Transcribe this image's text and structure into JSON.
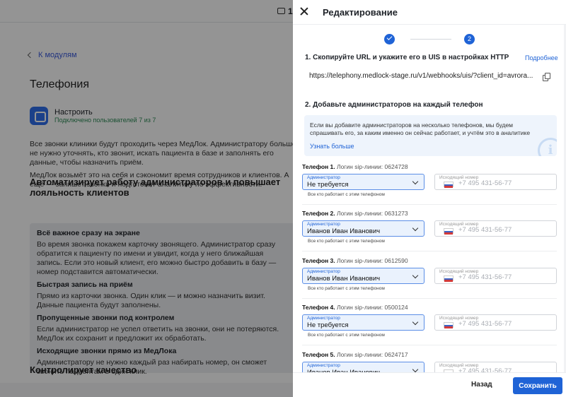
{
  "background": {
    "top_number": "1",
    "back_link": "К модулям",
    "page_title": "Телефония",
    "app": {
      "name": "Настроить",
      "status": "Подключено пользователей 7 из 7"
    },
    "intro_p1": "Все звонки клиники будут проходить через МедЛок. Администратору больше не нужно уточнять, кто звонит, искать пациента в базе и заполнять его данные, чтобы назначить приём.",
    "intro_p2": "МедЛок возьмёт это на себя и сэкономит время сотрудников и клиентов. А ещё — запишет звонки и подготовит аналитику по эффективности.",
    "section1_title": "Автоматизирует работу администраторов и повышает лояльность клиентов",
    "features": [
      {
        "title": "Всё важное сразу на экране",
        "text": "Во время звонка покажем карточку звонящего. Администратор сразу обратится к пациенту по имени и увидит, когда у него ближайшая запись. Если это новый клиент, его можно быстро добавить в базу — номер подставится автоматически."
      },
      {
        "title": "Быстрая запись на приём",
        "text": "Прямо из карточки звонка. Один клик — и можно назначить визит. Данные пациента будут заполнены."
      },
      {
        "title": "Пропущенные звонки под контролем",
        "text": "Если администратор не успел ответить на звонки, они не потеряются. МедЛок их сохранит и предложит их обработать."
      },
      {
        "title": "Исходящие звонки прямо из МедЛока",
        "text": "Администратору не нужно каждый раз набирать номер, он сможет звонить пациентам в один клик."
      }
    ],
    "section2_title": "Контролирует качество"
  },
  "drawer": {
    "title": "Редактирование",
    "steps": [
      {
        "label": ""
      },
      {
        "label": "2"
      }
    ],
    "section1": {
      "title": "1. Скопируйте URL и укажите его в UIS в настройках HTTP",
      "more_link": "Подробнее",
      "url": "https://telephony.medlock-stage.ru/v1/webhooks/uis/?client_id=avrora..."
    },
    "section2": {
      "title": "2. Добавьте администраторов на каждый телефон",
      "info_text": "Если вы добавите администраторов на несколько телефонов, мы будем спрашивать его, за каким именно он сейчас работает, и учтём это в аналитике",
      "info_link": "Узнать больше",
      "info_glyph": "i"
    },
    "phone_prefix": "Логин sip-линии:",
    "admin_field_label": "Администратор",
    "admin_hint": "Все кто работает с этим телефоном",
    "number_field_label": "Исходящий номер",
    "number_placeholder": "+7 495 431-56-77",
    "phones": [
      {
        "name": "Телефон 1.",
        "login": "0624728",
        "admin": "Не требуется"
      },
      {
        "name": "Телефон 2.",
        "login": "0631273",
        "admin": "Иванов Иван Иванович"
      },
      {
        "name": "Телефон 3.",
        "login": "0612590",
        "admin": "Иванов Иван Иванович"
      },
      {
        "name": "Телефон 4.",
        "login": "0500124",
        "admin": "Не требуется"
      },
      {
        "name": "Телефон 5.",
        "login": "0624717",
        "admin": "Иванов Иван Иванович"
      }
    ],
    "footer": {
      "back": "Назад",
      "save": "Сохранить"
    }
  },
  "colors": {
    "accent": "#1f63d6",
    "overlay": "rgba(0,0,0,0.42)",
    "select_bg": "#eaf2fd",
    "info_bg": "#eef4fc"
  },
  "icons": [
    "close-icon",
    "check-icon",
    "copy-icon",
    "info-icon",
    "chevron-down-icon",
    "flag-ru-icon",
    "chevron-left-icon",
    "phone-module-icon"
  ]
}
